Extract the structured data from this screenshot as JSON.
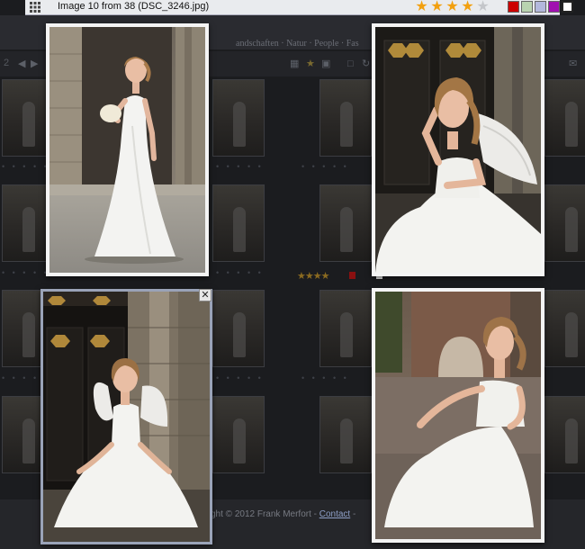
{
  "topbar": {
    "title": "Image 10 from 38 (DSC_3246.jpg)",
    "rating": 4,
    "rating_max": 5,
    "color_labels": [
      {
        "name": "red",
        "color": "#cc0000"
      },
      {
        "name": "green",
        "color": "#b9d3b0"
      },
      {
        "name": "blue",
        "color": "#b3b8dc"
      },
      {
        "name": "purple",
        "color": "#a010b0"
      },
      {
        "name": "white",
        "color": "#ffffff"
      }
    ],
    "selected_label": "white"
  },
  "background": {
    "header_text": "andschaften · Natur · People · Fas",
    "page_number": "2",
    "footer_text": "ght © 2012 Frank Merfort - ",
    "footer_link": "Contact",
    "footer_tail": " -"
  },
  "icons": {
    "grid": "grid-icon",
    "star": "star-icon",
    "close": "close-icon"
  },
  "photos": [
    {
      "name": "photo-bride-standing-courtyard"
    },
    {
      "name": "photo-bride-sitting-angel-wings"
    },
    {
      "name": "photo-bride-doorway-angel-wings"
    },
    {
      "name": "photo-bride-sitting-street"
    }
  ]
}
